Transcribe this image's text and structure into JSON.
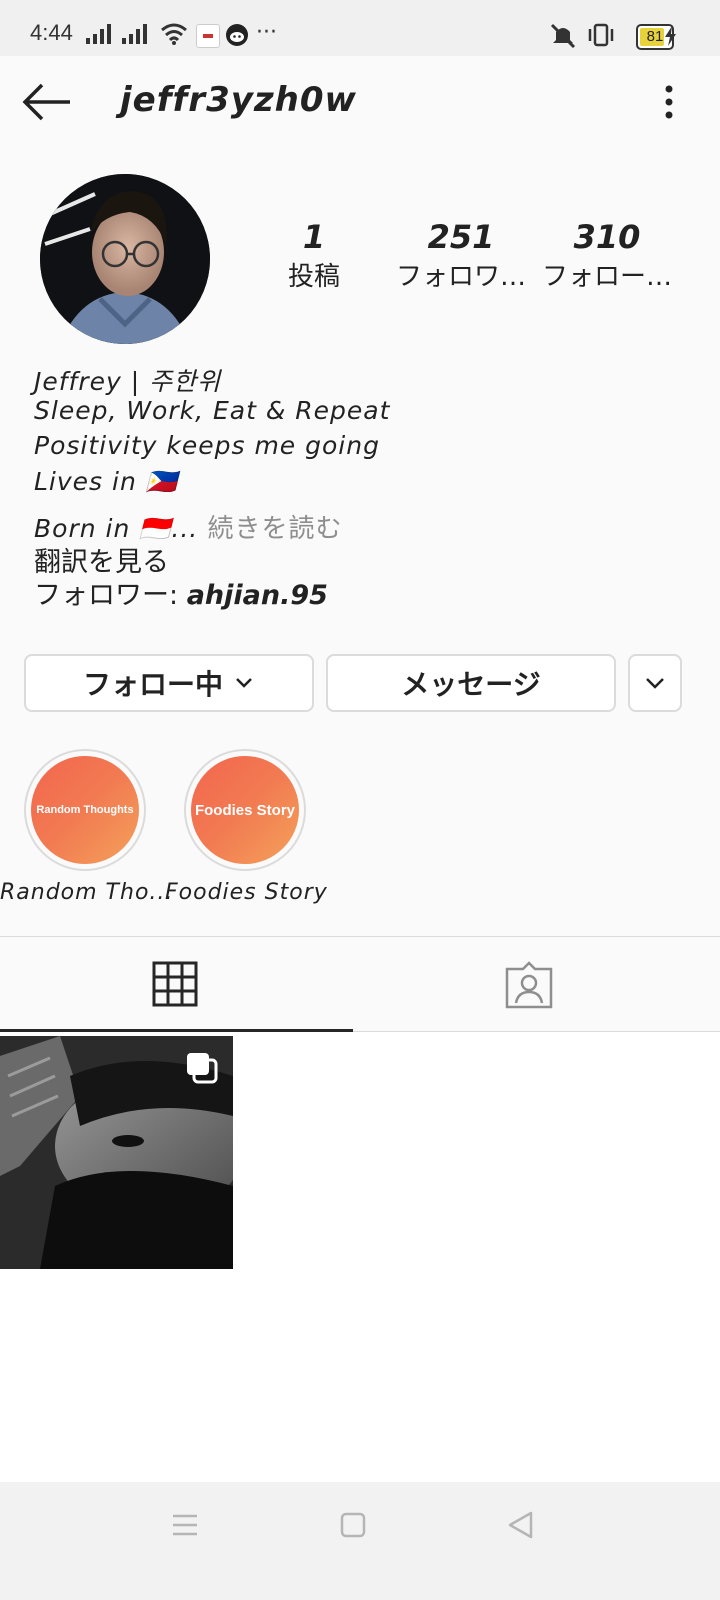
{
  "status_bar": {
    "time": "4:44",
    "more": "···",
    "battery": "81",
    "battery_level": 0.81
  },
  "header": {
    "username": "jeffr3yzh0w"
  },
  "stats": [
    {
      "value": "1",
      "label": "投稿"
    },
    {
      "value": "251",
      "label": "フォロワ…"
    },
    {
      "value": "310",
      "label": "フォロー…"
    }
  ],
  "bio": {
    "line1": "Jeffrey | 주한위",
    "line2": "Sleep, Work, Eat & Repeat",
    "line3": "Positivity keeps me going",
    "line4": "Lives in 🇵🇭",
    "line5": "Born in 🇮🇩...",
    "read_more": " 続きを読む",
    "translate": "翻訳を見る",
    "followers_prefix": "フォロワー: ",
    "followers_handle": "ahjian.95"
  },
  "actions": {
    "following": "フォロー中",
    "message": "メッセージ"
  },
  "highlights": [
    {
      "cover_text": "Random Thoughts",
      "label": "Random Tho..."
    },
    {
      "cover_text": "Foodies Story",
      "label": "Foodies Story"
    }
  ],
  "colors": {
    "accent_gradient_start": "#f2664e",
    "accent_gradient_end": "#f4a25a",
    "divider": "#dbdbdb",
    "text": "#262626"
  }
}
